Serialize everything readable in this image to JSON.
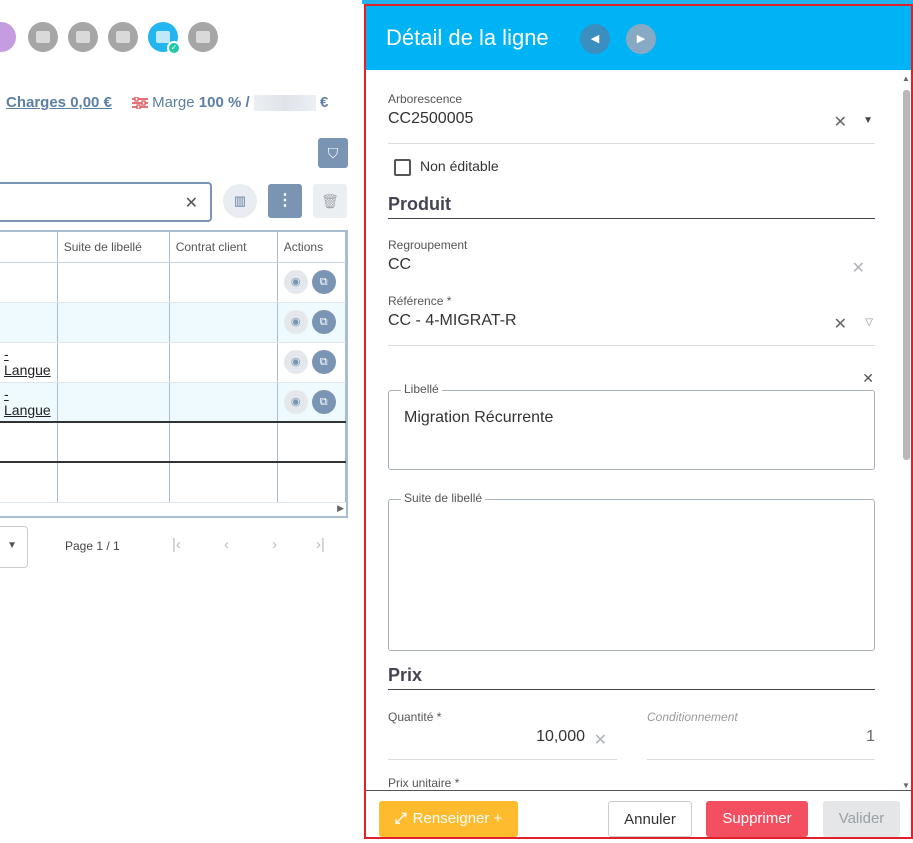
{
  "toolbar": {
    "charges_label": "Charges",
    "charges_value": "0,00 €",
    "marge_label": "Marge",
    "marge_value": "100 % /",
    "marge_currency": "€"
  },
  "grid": {
    "columns": [
      "Suite de libellé",
      "Contrat client",
      "Actions"
    ],
    "rows": [
      {
        "first": "",
        "suite": "",
        "contrat": ""
      },
      {
        "first": "",
        "suite": "",
        "contrat": ""
      },
      {
        "first": "-Langue",
        "suite": "",
        "contrat": ""
      },
      {
        "first": "-Langue",
        "suite": "",
        "contrat": ""
      },
      {
        "first": "",
        "suite": "",
        "contrat": ""
      },
      {
        "first": "",
        "suite": "",
        "contrat": ""
      }
    ]
  },
  "pager": {
    "page_info": "Page 1 / 1"
  },
  "panel": {
    "title": "Détail de la ligne",
    "arborescence_label": "Arborescence",
    "arborescence_value": "CC2500005",
    "non_editable_label": "Non éditable",
    "section_produit": "Produit",
    "regroupement_label": "Regroupement",
    "regroupement_value": "CC",
    "reference_label": "Référence *",
    "reference_value": "CC - 4-MIGRAT-R",
    "libelle_label": "Libellé",
    "libelle_value": "Migration Récurrente",
    "suite_label": "Suite de libellé",
    "suite_value": "",
    "section_prix": "Prix",
    "quantite_label": "Quantité *",
    "quantite_value": "10,000",
    "conditionnement_label": "Conditionnement",
    "conditionnement_value": "1",
    "prix_unitaire_label": "Prix unitaire *"
  },
  "footer": {
    "renseigner": "Renseigner +",
    "annuler": "Annuler",
    "supprimer": "Supprimer",
    "valider": "Valider"
  },
  "colors": {
    "header": "#00b3f4",
    "accent": "#7a95b3",
    "danger": "#f44e61",
    "warning": "#fdbb2d",
    "selection_outline": "#e0202a"
  }
}
